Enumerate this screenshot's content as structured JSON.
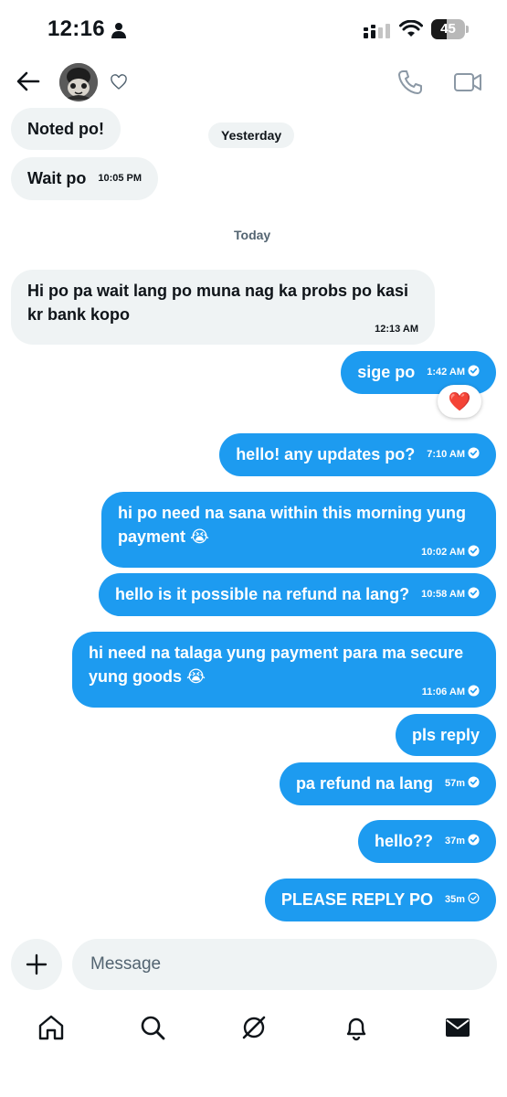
{
  "status_bar": {
    "time": "12:16",
    "battery": "45",
    "battery_level": 0.45
  },
  "header": {
    "back": "back",
    "avatar": "contact-avatar"
  },
  "day_labels": {
    "yesterday": "Yesterday",
    "today": "Today"
  },
  "messages": [
    {
      "text": "Noted po!",
      "time": "",
      "side": "received"
    },
    {
      "text": "Wait po",
      "time": "10:05 PM",
      "side": "received"
    },
    {
      "text": "Hi po pa wait lang po muna nag ka probs po kasi kr bank kopo",
      "time": "12:13 AM",
      "side": "received"
    },
    {
      "text": "sige po",
      "time": "1:42 AM",
      "side": "sent",
      "status": "read",
      "reaction": "❤️"
    },
    {
      "text": "hello! any updates po?",
      "time": "7:10 AM",
      "side": "sent",
      "status": "read"
    },
    {
      "text": "hi po need na sana within this morning yung payment 😭",
      "time": "10:02 AM",
      "side": "sent",
      "status": "read"
    },
    {
      "text": "hello is it possible na refund na lang?",
      "time": "10:58 AM",
      "side": "sent",
      "status": "read"
    },
    {
      "text": "hi need na talaga yung payment para ma secure yung goods 😭",
      "time": "11:06 AM",
      "side": "sent",
      "status": "read"
    },
    {
      "text": "pls reply",
      "time": "",
      "side": "sent"
    },
    {
      "text": "pa refund na lang",
      "time": "57m",
      "side": "sent",
      "status": "read"
    },
    {
      "text": "hello??",
      "time": "37m",
      "side": "sent",
      "status": "read"
    },
    {
      "text": "PLEASE REPLY PO",
      "time": "35m",
      "side": "sent",
      "status": "sent"
    }
  ],
  "composer": {
    "placeholder": "Message"
  },
  "nav": [
    "home-icon",
    "search-icon",
    "grok-icon",
    "notifications-icon",
    "messages-icon"
  ],
  "colors": {
    "accent": "#1d9bf0",
    "received_bg": "#eff3f4",
    "muted": "#536471",
    "heart": "#e0245e"
  }
}
